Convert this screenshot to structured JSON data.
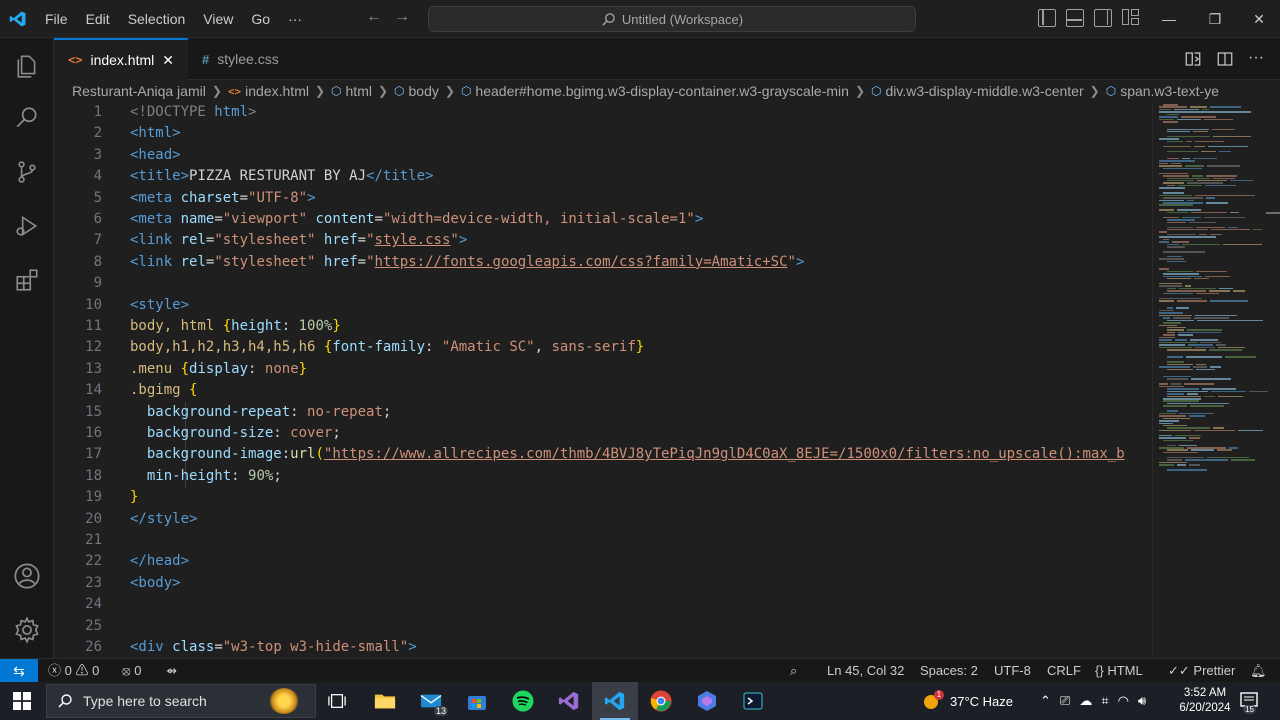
{
  "menu": [
    "File",
    "Edit",
    "Selection",
    "View",
    "Go",
    "···"
  ],
  "command_center": "Untitled (Workspace)",
  "tabs": [
    {
      "label": "index.html",
      "active": true
    },
    {
      "label": "stylee.css",
      "active": false
    }
  ],
  "breadcrumb": {
    "folder": "Resturant-Aniqa jamil",
    "file": "index.html",
    "html": "html",
    "body": "body",
    "header": "header#home.bgimg.w3-display-container.w3-grayscale-min",
    "div": "div.w3-display-middle.w3-center",
    "span": "span.w3-text-ye"
  },
  "line_numbers": [
    "1",
    "2",
    "3",
    "4",
    "5",
    "6",
    "7",
    "8",
    "9",
    "10",
    "11",
    "12",
    "13",
    "14",
    "15",
    "16",
    "17",
    "18",
    "19",
    "20",
    "21",
    "22",
    "23",
    "24",
    "25",
    "26"
  ],
  "code": {
    "l1_doctype": "<!DOCTYPE",
    "l1_html": "html",
    "l1_close": ">",
    "l2": "<html>",
    "l3": "<head>",
    "l4_open": "<title>",
    "l4_text": "PIZZA RESTURANT BY AJ",
    "l4_close": "</title>",
    "l5_tag": "<meta",
    "l5_attr": "charset",
    "l5_val": "\"UTF-8\"",
    "l6_tag": "<meta",
    "l6_attr1": "name",
    "l6_val1": "\"viewport\"",
    "l6_attr2": "content",
    "l6_val2": "\"width=device-width, initial-scale=1\"",
    "l7_tag": "<link",
    "l7_attr1": "rel",
    "l7_val1": "\"stylesheet\"",
    "l7_attr2": "href",
    "l7_val2a": "\"",
    "l7_val2b": "style.css",
    "l7_val2c": "\"",
    "l8_tag": "<link",
    "l8_attr1": "rel",
    "l8_val1": "\"stylesheet\"",
    "l8_attr2": "href",
    "l8_val2a": "\"",
    "l8_val2b": "https://fonts.googleapis.com/css?family=Amatic+SC",
    "l8_val2c": "\"",
    "l10": "<style>",
    "l11_sel": "body, html",
    "l11_prop": "height",
    "l11_val": "100%",
    "l12_sel": "body,h1,h2,h3,h4,h5,h6",
    "l12_prop": "font-family",
    "l12_val1": "\"Amatic SC\"",
    "l12_val2": "sans-serif",
    "l13_sel": ".menu",
    "l13_prop": "display",
    "l13_val": "none",
    "l14_sel": ".bgimg",
    "l15_prop": "background-repeat",
    "l15_val": "no-repeat",
    "l16_prop": "background-size",
    "l16_val": "cover",
    "l17_prop": "background-image",
    "l17_fn": "url",
    "l17_val": "\"https://www.allrecipes.com/thmb/4BVJ8yTePiqJn9glD4C0aX_8EJE=/1500x0/filters:no_upscale():max_b",
    "l18_prop": "min-height",
    "l18_val": "90%",
    "l20": "</style>",
    "l22": "</head>",
    "l23": "<body>",
    "l26_tag": "<div",
    "l26_attr": "class",
    "l26_val": "\"w3-top w3-hide-small\""
  },
  "status": {
    "errors": "0",
    "warnings": "0",
    "ports": "0",
    "position": "Ln 45, Col 32",
    "spaces": "Spaces: 2",
    "encoding": "UTF-8",
    "eol": "CRLF",
    "language": "HTML",
    "formatter": "Prettier"
  },
  "taskbar": {
    "search_placeholder": "Type here to search",
    "mail_badge": "13",
    "weather_badge": "1",
    "temperature": "37°C",
    "weather": "Haze",
    "time": "3:52 AM",
    "date": "6/20/2024",
    "notif_count": "15"
  },
  "icons": {
    "explorer": "files-icon",
    "search": "search-icon",
    "source_control": "source-control-icon",
    "run_debug": "run-debug-icon",
    "extensions": "extensions-icon",
    "accounts": "account-icon",
    "manage": "gear-icon"
  },
  "colors": {
    "accent": "#0078d4",
    "background": "#1f1f1f",
    "tag": "#569cd6",
    "attribute": "#9cdcfe",
    "string": "#ce9178",
    "selector": "#d7ba7d"
  }
}
